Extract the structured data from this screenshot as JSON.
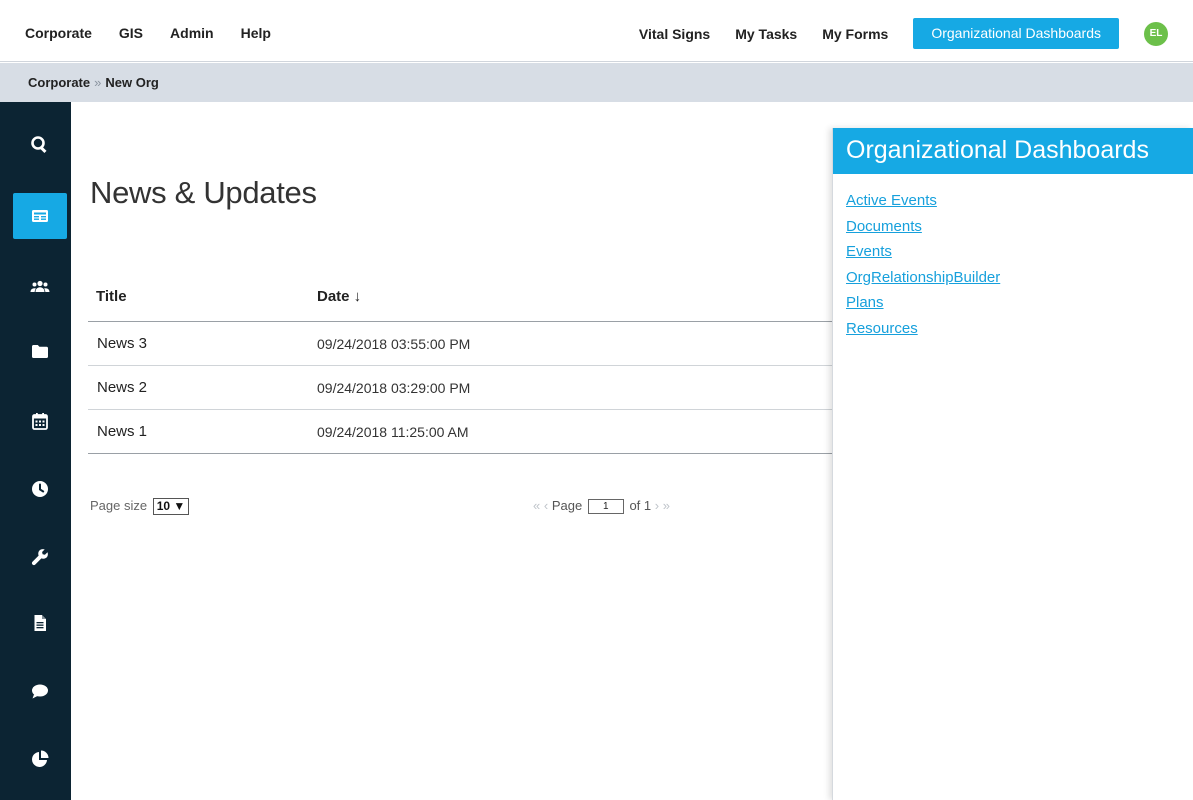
{
  "topnav": {
    "left": [
      "Corporate",
      "GIS",
      "Admin",
      "Help"
    ],
    "right": [
      "Vital Signs",
      "My Tasks",
      "My Forms"
    ],
    "active_button": "Organizational Dashboards",
    "avatar_initials": "EL"
  },
  "breadcrumb": {
    "root": "Corporate",
    "separator": "»",
    "current": "New Org"
  },
  "sidebar": {
    "icons": [
      "search-icon",
      "news-icon",
      "people-icon",
      "folder-icon",
      "calendar-icon",
      "clock-icon",
      "wrench-icon",
      "document-icon",
      "chat-icon",
      "pie-chart-icon"
    ],
    "active": "news-icon"
  },
  "main": {
    "title": "News & Updates",
    "columns": {
      "title": "Title",
      "date": "Date ↓"
    },
    "rows": [
      {
        "title": "News 3",
        "date": "09/24/2018 03:55:00 PM"
      },
      {
        "title": "News 2",
        "date": "09/24/2018 03:29:00 PM"
      },
      {
        "title": "News 1",
        "date": "09/24/2018 11:25:00 AM"
      }
    ],
    "pager": {
      "page_size_label": "Page size",
      "page_size_value": "10 ▼",
      "first": "«",
      "prev": "‹",
      "page_label": "Page",
      "page_value": "1",
      "of_label": "of 1",
      "next": "›",
      "last": "»"
    }
  },
  "panel": {
    "title": "Organizational Dashboards",
    "links": [
      "Active Events",
      "Documents",
      "Events",
      "OrgRelationshipBuilder",
      "Plans",
      "Resources"
    ]
  },
  "colors": {
    "accent": "#16a9e4",
    "sidebar_bg": "#0c2433",
    "breadcrumb_bg": "#d7dde5",
    "avatar_bg": "#6cc04a"
  }
}
